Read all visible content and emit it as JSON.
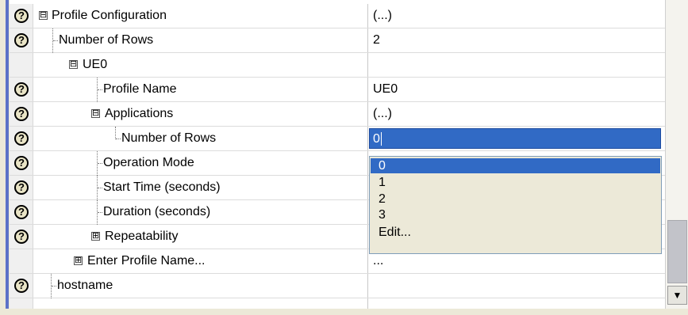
{
  "rows": [
    {
      "name": "Profile Configuration",
      "value": "(...)",
      "help": true,
      "toggle": "⊟"
    },
    {
      "name": "Number of Rows",
      "value": "2",
      "help": true
    },
    {
      "name": "UE0",
      "value": "",
      "help": false,
      "toggle": "⊟"
    },
    {
      "name": "Profile Name",
      "value": "UE0",
      "help": true
    },
    {
      "name": "Applications",
      "value": "(...)",
      "help": true,
      "toggle": "⊟"
    },
    {
      "name": "Number of Rows",
      "value": "0",
      "help": true
    },
    {
      "name": "Operation Mode",
      "value": "",
      "help": true
    },
    {
      "name": "Start Time (seconds)",
      "value": "",
      "help": true
    },
    {
      "name": "Duration (seconds)",
      "value": "",
      "help": true
    },
    {
      "name": "Repeatability",
      "value": "",
      "help": true,
      "toggle": "⊞"
    },
    {
      "name": "Enter Profile Name...",
      "value": "...",
      "help": false,
      "toggle": "⊞"
    },
    {
      "name": "hostname",
      "value": "",
      "help": true
    }
  ],
  "help_icon_glyph": "?",
  "dropdown": {
    "options": [
      "0",
      "1",
      "2",
      "3",
      "Edit..."
    ],
    "selected": "0"
  },
  "scroll_down_glyph": "▼"
}
